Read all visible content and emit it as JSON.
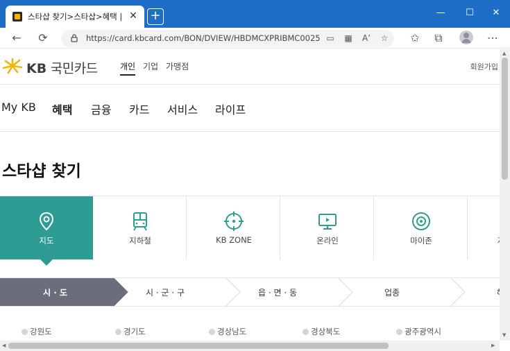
{
  "browser": {
    "tab_title": "스타샵 찾기>스타샵>혜택 | 국민카드",
    "tab_close": "✕",
    "new_tab": "+",
    "url": "https://card.kbcard.com/BON/DVIEW/HBDMCXPRIBMC0025",
    "window_controls": [
      "—",
      "☐",
      "✕"
    ]
  },
  "header": {
    "logo_kb": "KB",
    "logo_name": "국민카드",
    "segments": [
      "개인",
      "기업",
      "가맹점"
    ],
    "member_link": "회원가입"
  },
  "gnb": {
    "items": [
      "My KB",
      "혜택",
      "금융",
      "카드",
      "서비스",
      "라이프"
    ],
    "highlighted": "혜택"
  },
  "page_title": "스타샵 찾기",
  "categories": [
    {
      "label": "지도",
      "icon": "map-pin-icon",
      "active": true
    },
    {
      "label": "지하철",
      "icon": "subway-icon",
      "active": false
    },
    {
      "label": "KB ZONE",
      "icon": "target-icon",
      "active": false
    },
    {
      "label": "온라인",
      "icon": "monitor-icon",
      "active": false
    },
    {
      "label": "마이존",
      "icon": "my-zone-icon",
      "active": false
    },
    {
      "label": "지",
      "icon": "more-icon",
      "active": false
    }
  ],
  "steps": [
    "시 · 도",
    "시 · 군 · 구",
    "읍 · 면 · 동",
    "업종",
    "혜"
  ],
  "regions": [
    "강원도",
    "경기도",
    "경상남도",
    "경상북도",
    "광주광역시"
  ],
  "colors": {
    "titlebar": "#1e6ec8",
    "accent_teal": "#2f9c94",
    "highlight_yellow": "#ffd21f",
    "step_active": "#6b6d7c",
    "logo_star": "#f2b600"
  }
}
